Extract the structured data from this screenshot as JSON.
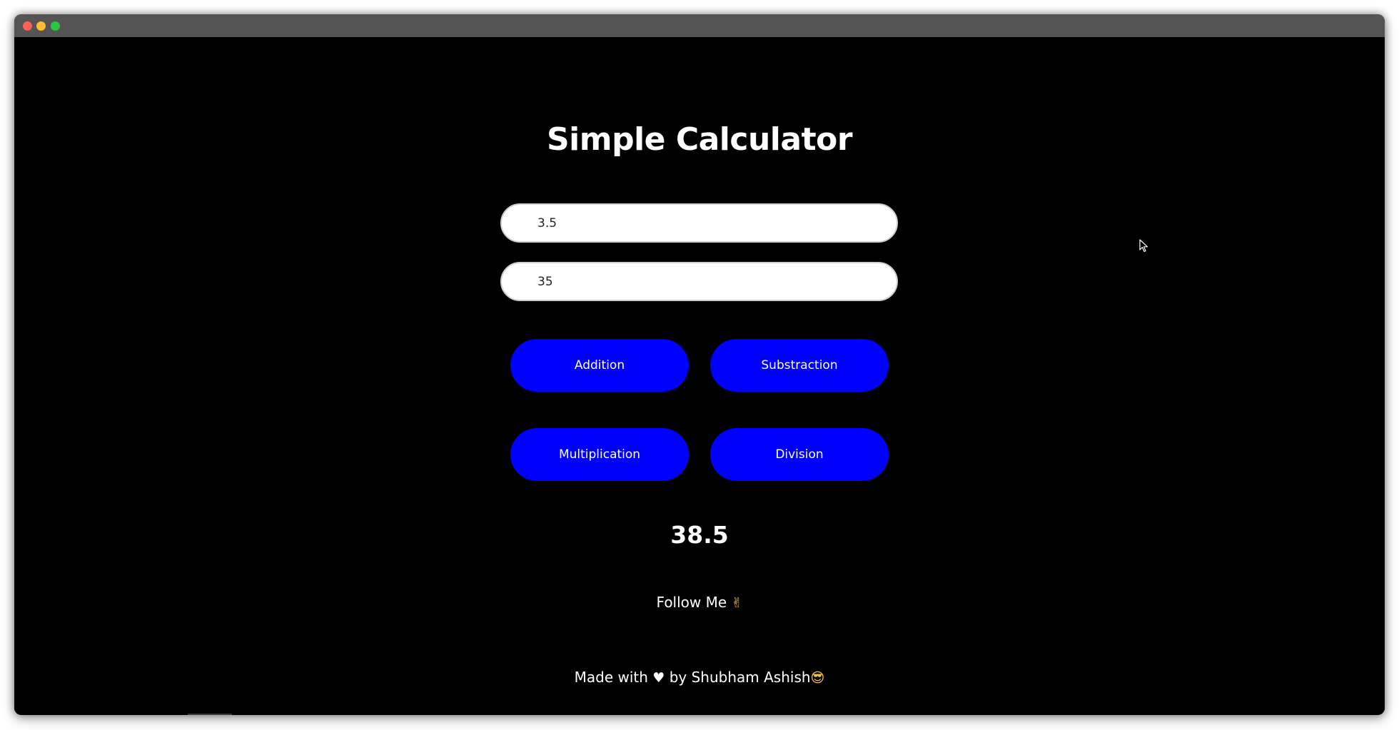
{
  "app": {
    "title": "Simple Calculator"
  },
  "inputs": {
    "first_value": "3.5",
    "second_value": "35"
  },
  "buttons": {
    "addition": "Addition",
    "subtraction": "Substraction",
    "multiplication": "Multiplication",
    "division": "Division"
  },
  "result": {
    "value": "38.5"
  },
  "follow": {
    "label": "Follow Me",
    "emoji": "✌"
  },
  "footer": {
    "prefix": "Made with",
    "heart": "♥",
    "suffix": "by Shubham Ashish",
    "emoji": "😎"
  },
  "colors": {
    "background": "#000000",
    "button": "#0000ff",
    "input_bg": "#ffffff",
    "titlebar": "#545454"
  },
  "icons": {
    "window_controls": [
      "close-icon",
      "minimize-icon",
      "maximize-icon"
    ],
    "cursor": "mouse-pointer-icon"
  }
}
